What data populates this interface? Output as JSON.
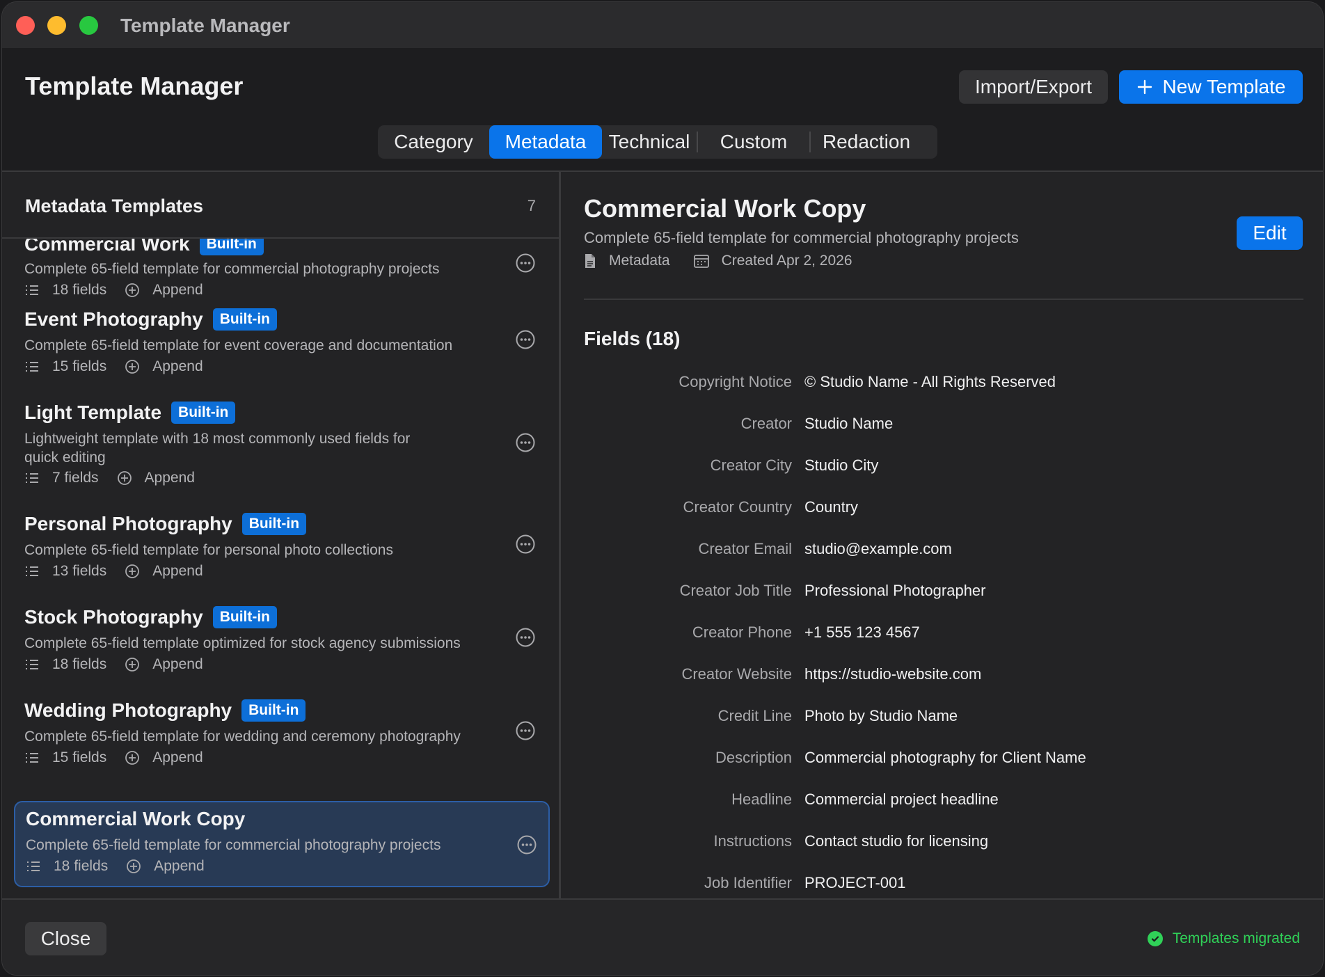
{
  "window": {
    "title": "Template Manager"
  },
  "header": {
    "title": "Template Manager",
    "import_export_label": "Import/Export",
    "new_template_label": "New Template",
    "tabs": [
      {
        "label": "Category",
        "active": false
      },
      {
        "label": "Metadata",
        "active": true
      },
      {
        "label": "Technical",
        "active": false
      },
      {
        "label": "Custom",
        "active": false
      },
      {
        "label": "Redaction",
        "active": false
      }
    ]
  },
  "list": {
    "title": "Metadata Templates",
    "count": "7",
    "items": [
      {
        "title": "Commercial Work",
        "badge": "Built-in",
        "description": "Complete 65-field template for commercial photography projects",
        "fields": "18 fields",
        "mode": "Append"
      },
      {
        "title": "Event Photography",
        "badge": "Built-in",
        "description": "Complete 65-field template for event coverage and documentation",
        "fields": "15 fields",
        "mode": "Append"
      },
      {
        "title": "Light Template",
        "badge": "Built-in",
        "description": "Lightweight template with 18 most commonly used fields for quick editing",
        "fields": "7 fields",
        "mode": "Append"
      },
      {
        "title": "Personal Photography",
        "badge": "Built-in",
        "description": "Complete 65-field template for personal photo collections",
        "fields": "13 fields",
        "mode": "Append"
      },
      {
        "title": "Stock Photography",
        "badge": "Built-in",
        "description": "Complete 65-field template optimized for stock agency submissions",
        "fields": "18 fields",
        "mode": "Append"
      },
      {
        "title": "Wedding Photography",
        "badge": "Built-in",
        "description": "Complete 65-field template for wedding and ceremony photography",
        "fields": "15 fields",
        "mode": "Append"
      },
      {
        "title": "Commercial Work Copy",
        "badge": "",
        "description": "Complete 65-field template for commercial photography projects",
        "fields": "18 fields",
        "mode": "Append",
        "selected": true
      }
    ]
  },
  "detail": {
    "title": "Commercial Work Copy",
    "description": "Complete 65-field template for commercial photography projects",
    "type": "Metadata",
    "created": "Created Apr 2, 2026",
    "edit_label": "Edit",
    "fields_title": "Fields (18)",
    "fields": [
      {
        "label": "Copyright Notice",
        "value": "© Studio Name - All Rights Reserved"
      },
      {
        "label": "Creator",
        "value": "Studio Name"
      },
      {
        "label": "Creator City",
        "value": "Studio City"
      },
      {
        "label": "Creator Country",
        "value": "Country"
      },
      {
        "label": "Creator Email",
        "value": "studio@example.com"
      },
      {
        "label": "Creator Job Title",
        "value": "Professional Photographer"
      },
      {
        "label": "Creator Phone",
        "value": "+1 555 123 4567"
      },
      {
        "label": "Creator Website",
        "value": "https://studio-website.com"
      },
      {
        "label": "Credit Line",
        "value": "Photo by Studio Name"
      },
      {
        "label": "Description",
        "value": "Commercial photography for Client Name"
      },
      {
        "label": "Headline",
        "value": "Commercial project headline"
      },
      {
        "label": "Instructions",
        "value": "Contact studio for licensing"
      },
      {
        "label": "Job Identifier",
        "value": "PROJECT-001"
      }
    ]
  },
  "footer": {
    "close_label": "Close",
    "status": "Templates migrated"
  },
  "colors": {
    "accent": "#0a74ea",
    "success": "#30d158",
    "badge": "#0d6fd8",
    "selected_bg": "#283a55"
  }
}
